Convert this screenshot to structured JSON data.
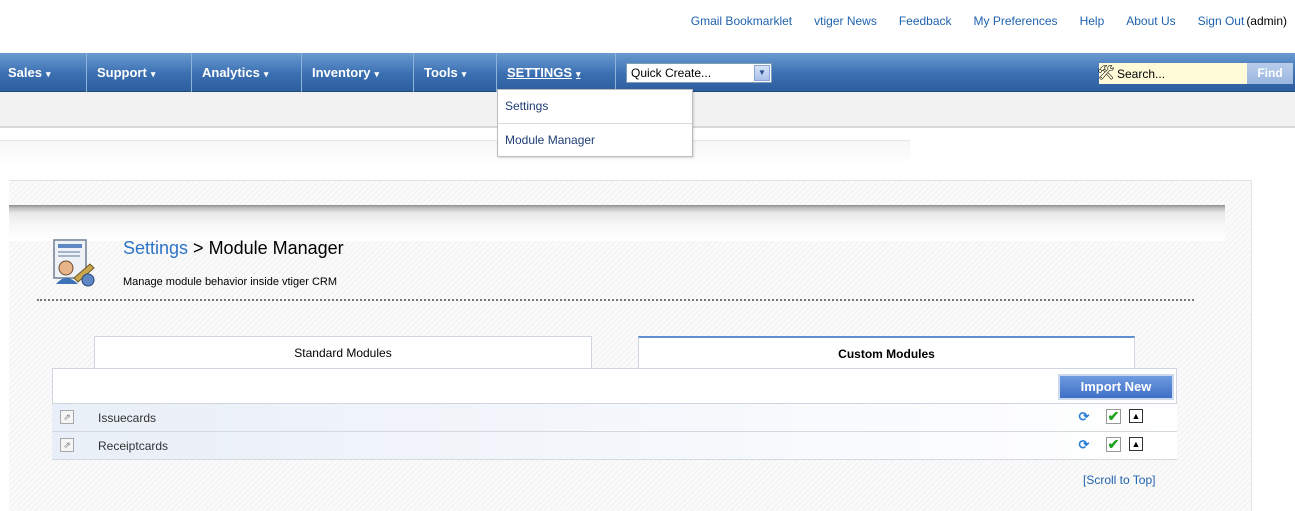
{
  "toplinks": {
    "gmail": "Gmail Bookmarklet",
    "news": "vtiger News",
    "feedback": "Feedback",
    "preferences": "My Preferences",
    "help": "Help",
    "about": "About Us",
    "signout": "Sign Out",
    "user": "(admin)"
  },
  "nav": {
    "items": [
      {
        "label": "Sales"
      },
      {
        "label": "Support"
      },
      {
        "label": "Analytics"
      },
      {
        "label": "Inventory"
      },
      {
        "label": "Tools"
      },
      {
        "label": "SETTINGS"
      }
    ],
    "caret": "▾",
    "quick_create": "Quick Create...",
    "search_placeholder": "Search...",
    "find_label": "Find"
  },
  "dropdown": {
    "items": [
      "Settings",
      "Module Manager"
    ]
  },
  "page": {
    "crumb": "Settings",
    "separator": " > ",
    "title": "Module Manager",
    "subtitle": "Manage module behavior inside vtiger CRM"
  },
  "tabs": {
    "standard": "Standard Modules",
    "custom": "Custom Modules"
  },
  "toolbar": {
    "import_label": "Import New"
  },
  "modules": [
    {
      "name": "Issuecards"
    },
    {
      "name": "Receiptcards"
    }
  ],
  "scroll_top": "[Scroll to Top]",
  "colors": {
    "nav_bg": "#3a6fb1",
    "link": "#1f62ae",
    "crumb": "#2d73c7",
    "import_btn": "#3f6fc6"
  },
  "icons": [
    "search-icon",
    "dropdown-arrow-icon",
    "module-settings-icon",
    "link-icon",
    "refresh-icon",
    "check-icon",
    "export-icon"
  ]
}
